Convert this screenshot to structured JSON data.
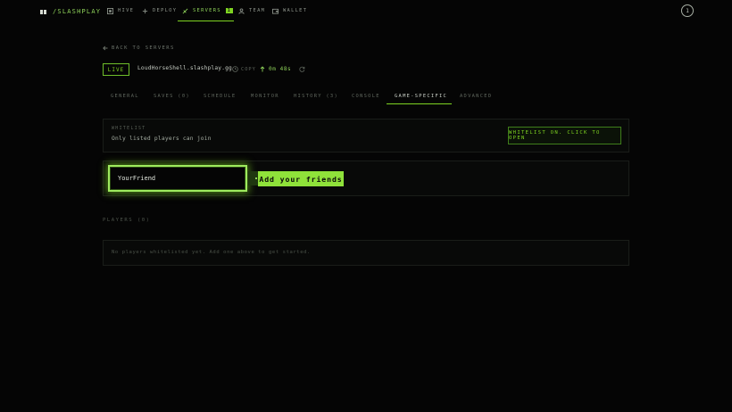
{
  "brand": {
    "name": "/SLASHPLAY"
  },
  "nav": {
    "items": [
      {
        "label": "HIVE",
        "icon": "hive-icon"
      },
      {
        "label": "DEPLOY",
        "icon": "plus-icon"
      },
      {
        "label": "SERVERS",
        "icon": "rocket-icon",
        "badge": "1",
        "active": true
      },
      {
        "label": "TEAM",
        "icon": "team-icon"
      },
      {
        "label": "WALLET",
        "icon": "wallet-icon"
      }
    ],
    "avatar": "1"
  },
  "back": {
    "label": "BACK TO SERVERS"
  },
  "server": {
    "status": "LIVE",
    "host": "LoudHorseShell.slashplay.gg",
    "copy_label": "COPY",
    "uptime": "0m 48s"
  },
  "tabs": [
    {
      "label": "GENERAL"
    },
    {
      "label": "SAVES (0)"
    },
    {
      "label": "SCHEDULE"
    },
    {
      "label": "MONITOR"
    },
    {
      "label": "HISTORY (3)"
    },
    {
      "label": "CONSOLE"
    },
    {
      "label": "GAME-SPECIFIC",
      "active": true
    },
    {
      "label": "ADVANCED"
    }
  ],
  "whitelist": {
    "label": "WHITELIST",
    "description": "Only listed players can join",
    "toggle_label": "WHITELIST ON. CLICK TO OPEN"
  },
  "add_player": {
    "input_value": "YourFriend",
    "tooltip": "Add your friends"
  },
  "players": {
    "heading": "PLAYERS (0)",
    "empty_text": "No players whitelisted yet. Add one above to get started."
  },
  "colors": {
    "accent": "#7ed321",
    "background": "#050505",
    "card_border": "#1a1d19"
  }
}
